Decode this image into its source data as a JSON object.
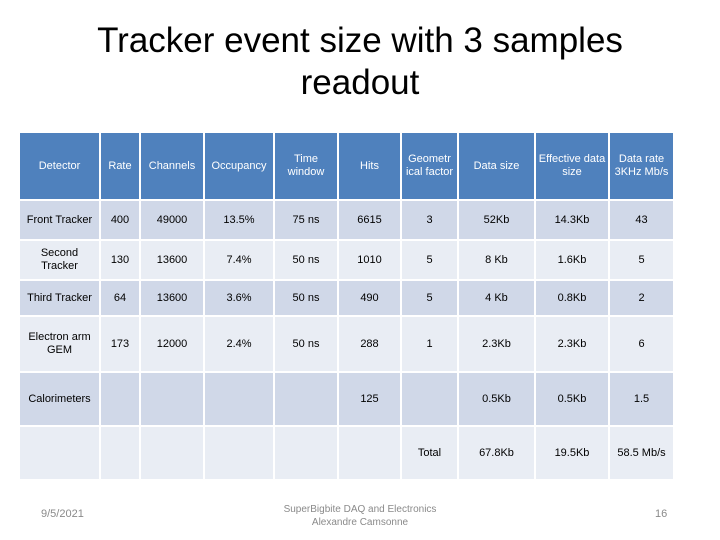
{
  "slide": {
    "title": "Tracker event size with 3 samples readout",
    "footer": {
      "date": "9/5/2021",
      "center_line1": "SuperBigbite DAQ and Electronics",
      "center_line2": "Alexandre Camsonne",
      "page_number": "16"
    }
  },
  "colors": {
    "header_bg": "#4f81bd",
    "row_dark": "#d0d8e8",
    "row_light": "#e9edf4"
  },
  "table": {
    "headers": [
      "Detector",
      "Rate",
      "Channels",
      "Occupancy",
      "Time window",
      "Hits",
      "Geometr ical factor",
      "Data size",
      "Effective data size",
      "Data rate 3KHz Mb/s"
    ],
    "rows": [
      [
        "Front Tracker",
        "400",
        "49000",
        "13.5%",
        "75 ns",
        "6615",
        "3",
        "52Kb",
        "14.3Kb",
        "43"
      ],
      [
        "Second Tracker",
        "130",
        "13600",
        "7.4%",
        "50 ns",
        "1010",
        "5",
        "8 Kb",
        "1.6Kb",
        "5"
      ],
      [
        "Third Tracker",
        "64",
        "13600",
        "3.6%",
        "50 ns",
        "490",
        "5",
        "4 Kb",
        "0.8Kb",
        "2"
      ],
      [
        "Electron arm GEM",
        "173",
        "12000",
        "2.4%",
        "50 ns",
        "288",
        "1",
        "2.3Kb",
        "2.3Kb",
        "6"
      ],
      [
        "Calorimeters",
        "",
        "",
        "",
        "",
        "125",
        "",
        "0.5Kb",
        "0.5Kb",
        "1.5"
      ],
      [
        "",
        "",
        "",
        "",
        "",
        "",
        "Total",
        "67.8Kb",
        "19.5Kb",
        "58.5 Mb/s"
      ]
    ]
  }
}
